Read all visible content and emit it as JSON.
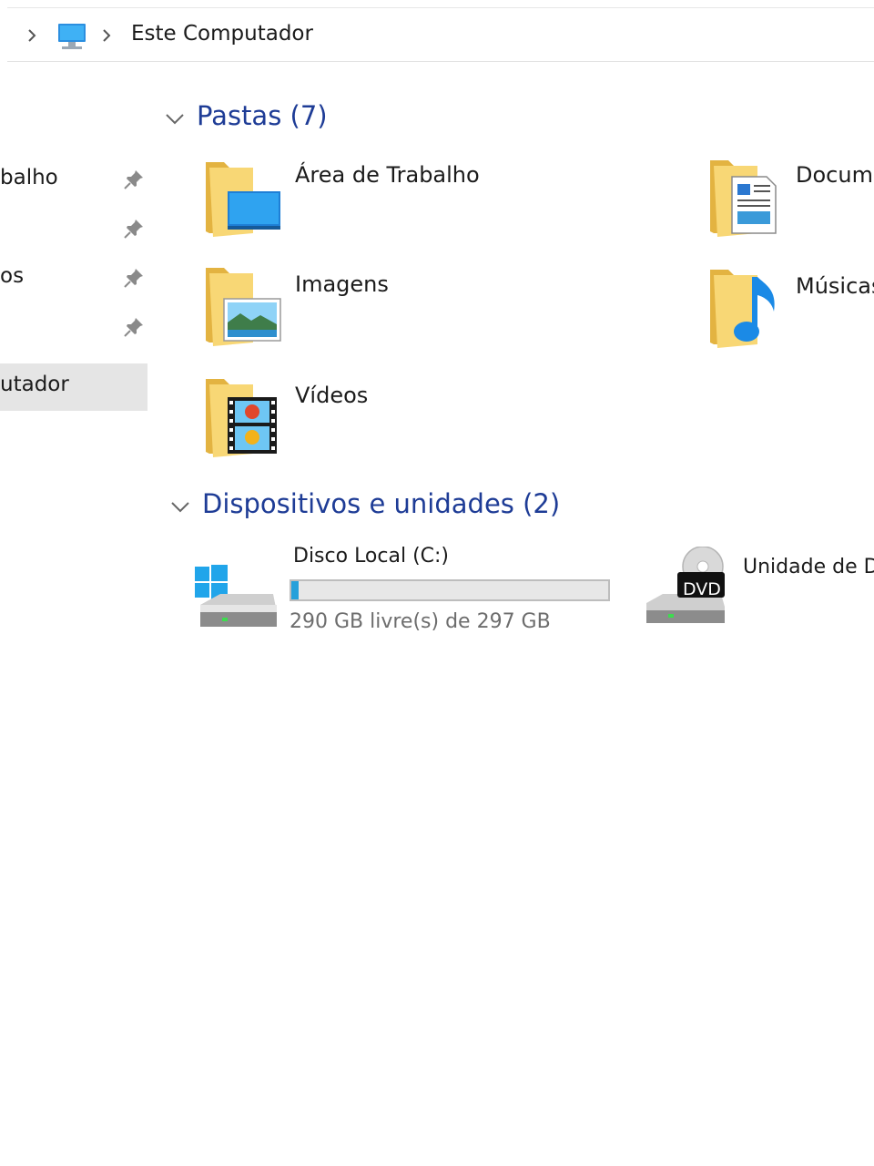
{
  "breadcrumb": {
    "location": "Este Computador"
  },
  "nav": {
    "items": [
      {
        "label": "balho",
        "pinned": true
      },
      {
        "label": "",
        "pinned": true
      },
      {
        "label": "os",
        "pinned": true
      },
      {
        "label": "",
        "pinned": true
      },
      {
        "label": "utador",
        "pinned": false,
        "selected": true
      }
    ]
  },
  "folders": {
    "header": "Pastas (7)",
    "items": [
      {
        "label": "Área de Trabalho",
        "icon": "desktop-folder-icon"
      },
      {
        "label": "Docume",
        "icon": "documents-folder-icon"
      },
      {
        "label": "Imagens",
        "icon": "pictures-folder-icon"
      },
      {
        "label": "Músicas",
        "icon": "music-folder-icon"
      },
      {
        "label": "Vídeos",
        "icon": "videos-folder-icon"
      }
    ]
  },
  "devices": {
    "header": "Dispositivos e unidades (2)",
    "items": [
      {
        "name": "Disco Local (C:)",
        "free_text": "290 GB livre(s) de 297 GB",
        "used_fraction": 0.024,
        "icon": "windows-drive-icon"
      },
      {
        "name": "Unidade de DV",
        "icon": "dvd-drive-icon",
        "badge": "DVD"
      }
    ]
  },
  "colors": {
    "accent_header": "#1e3c96",
    "usage_bar": "#26a0da",
    "selected_nav": "#e5e5e5"
  }
}
